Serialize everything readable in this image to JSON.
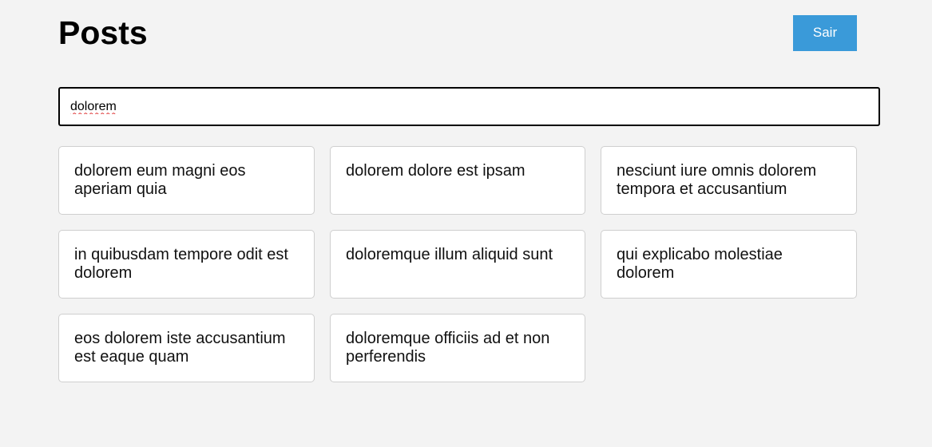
{
  "header": {
    "title": "Posts",
    "logout_label": "Sair"
  },
  "search": {
    "value": "dolorem",
    "placeholder": ""
  },
  "posts": [
    {
      "title": "dolorem eum magni eos aperiam quia"
    },
    {
      "title": "dolorem dolore est ipsam"
    },
    {
      "title": "nesciunt iure omnis dolorem tempora et accusantium"
    },
    {
      "title": "in quibusdam tempore odit est dolorem"
    },
    {
      "title": "doloremque illum aliquid sunt"
    },
    {
      "title": "qui explicabo molestiae dolorem"
    },
    {
      "title": "eos dolorem iste accusantium est eaque quam"
    },
    {
      "title": "doloremque officiis ad et non perferendis"
    }
  ],
  "colors": {
    "background": "#f3f3f3",
    "accent": "#3a9ad9",
    "card_background": "#ffffff",
    "card_border": "#cfcfcf"
  }
}
